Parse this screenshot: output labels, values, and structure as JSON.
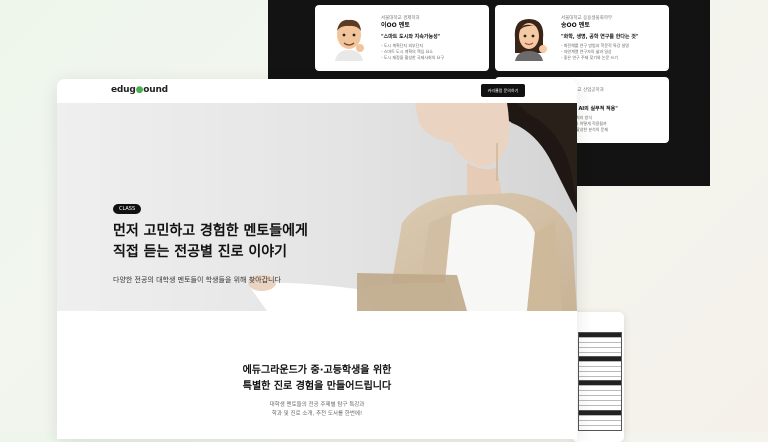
{
  "bg_page": {
    "mentor_cards": [
      {
        "school": "서울대학교 경제학과",
        "name": "이OO 멘토",
        "quote": "\"스마트 도시와 지속가능성\"",
        "points": [
          "- 도시 계획단지 외부단지",
          "- 스마트 도시 계획의 핵심 요소",
          "- 도시 재정을 활성한 국제사회의 요구"
        ]
      },
      {
        "school": "서울대학교 응용생물화학부",
        "name": "송OO 멘토",
        "quote": "\"화학, 생명, 공학 연구를 한다는 것\"",
        "points": [
          "- 화전해를 연구 방법과 학문적 특강 설명",
          "- 자연계열 연구자의 삶과 일상",
          "- 좋은 연구 주제 찾기와 논문 쓰기"
        ]
      },
      {
        "school": "서울대학교 산업공학과",
        "name": "멘토",
        "quote": "입러닝, AI의 실무적 적용\"",
        "points": [
          "- 데이터 처리 방식",
          "- 산업에서 어떻게 적용될까",
          "- 생활을 활성한 분석의 문제"
        ]
      }
    ]
  },
  "main": {
    "logo": {
      "part1": "edug",
      "part2": "ound"
    },
    "cta_label": "커리큘럼 문의하기",
    "hero": {
      "badge": "CLASS",
      "title_line1": "먼저 고민하고 경험한 멘토들에게",
      "title_line2": "직접 듣는 전공별 진로 이야기",
      "subtitle": "다양한 전공의 대학생 멘토들이 학생들을 위해 찾아갑니다"
    },
    "section2": {
      "title_line1": "에듀그라운드가 중·고등학생을 위한",
      "title_line2": "특별한 진로 경험을 만들어드립니다",
      "desc_line1": "대학생 멘토들의 전공 주제별 탐구 특강과",
      "desc_line2": "학과 및 진로 소개, 추천 도서를 한번에!"
    }
  },
  "colors": {
    "dark_bg": "#131313",
    "accent_green": "#4caf50",
    "text_primary": "#111111"
  }
}
